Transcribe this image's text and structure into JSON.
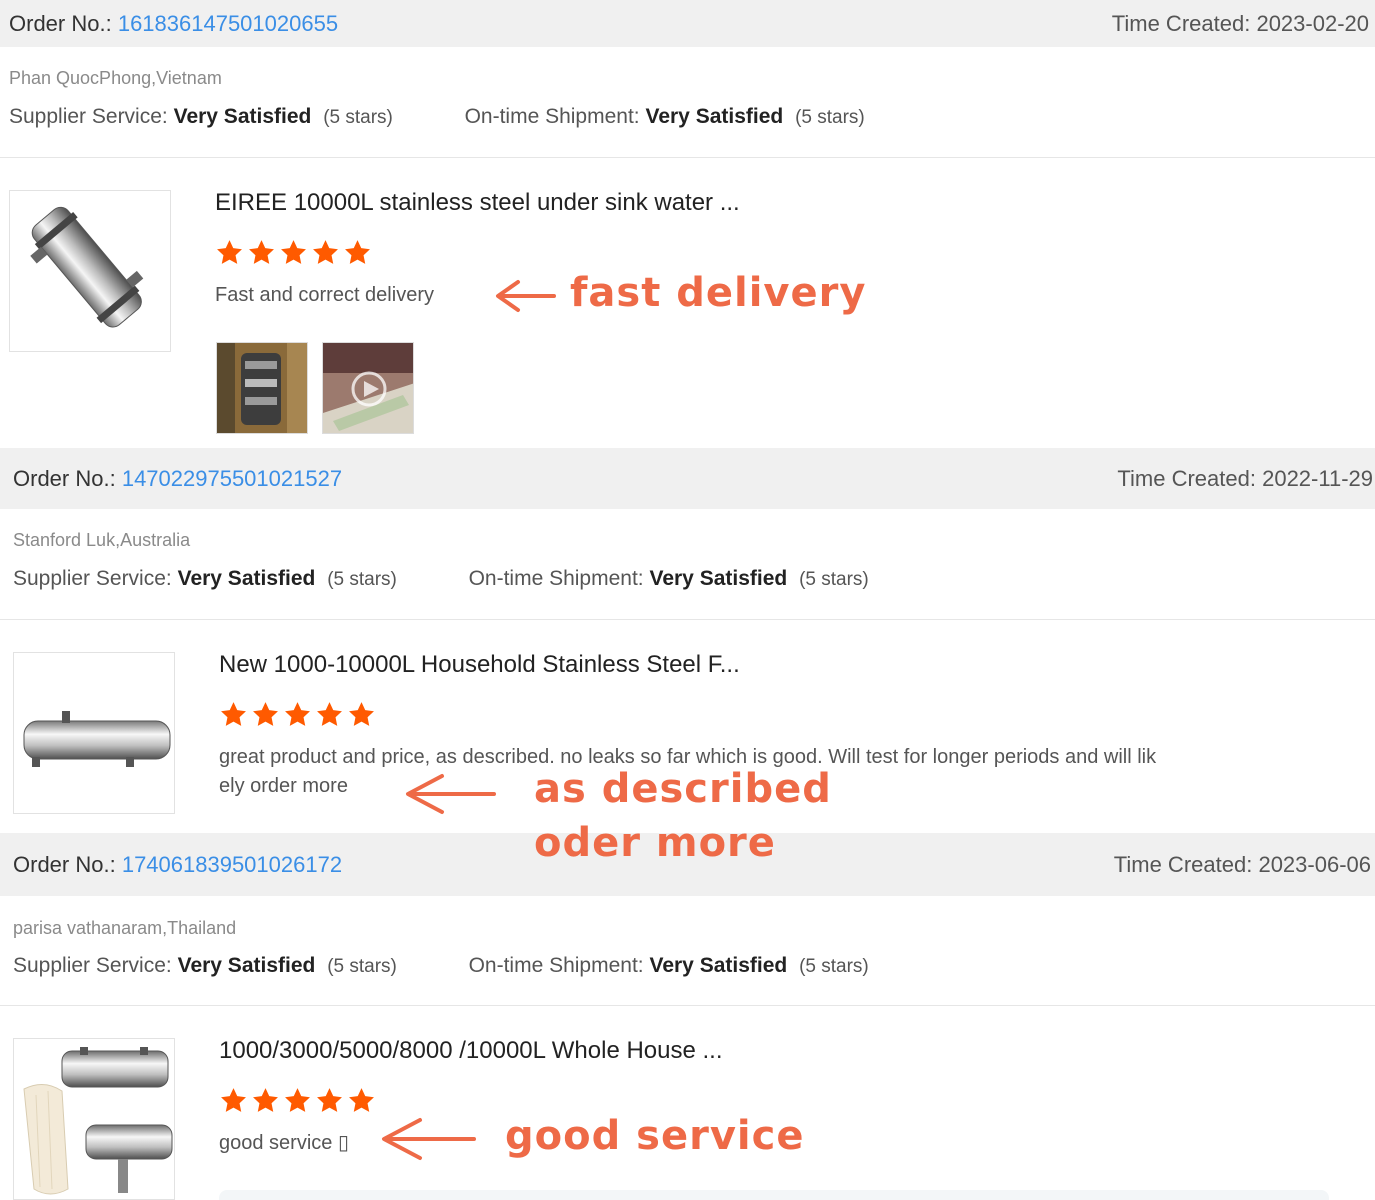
{
  "orders": [
    {
      "order_label": "Order No.:",
      "order_number": "161836147501020655",
      "time_label": "Time Created:",
      "time_value": "2023-02-20",
      "buyer": "Phan QuocPhong,Vietnam",
      "supplier_label": "Supplier Service:",
      "supplier_value": "Very Satisfied",
      "supplier_stars": "(5 stars)",
      "shipment_label": "On-time Shipment:",
      "shipment_value": "Very Satisfied",
      "shipment_stars": "(5 stars)",
      "product_title": "EIREE 10000L stainless steel under sink water ...",
      "rating": 5,
      "review": "Fast and correct delivery",
      "annotation": "fast delivery"
    },
    {
      "order_label": "Order No.:",
      "order_number": "147022975501021527",
      "time_label": "Time Created:",
      "time_value": "2022-11-29",
      "buyer": "Stanford Luk,Australia",
      "supplier_label": "Supplier Service:",
      "supplier_value": "Very Satisfied",
      "supplier_stars": "(5 stars)",
      "shipment_label": "On-time Shipment:",
      "shipment_value": "Very Satisfied",
      "shipment_stars": "(5 stars)",
      "product_title": "New 1000-10000L Household Stainless Steel F...",
      "rating": 5,
      "review_line1": "great product and price, as described. no leaks so far which is good. Will test for longer periods and will lik",
      "review_line2": "ely order more",
      "annotation_1": "as described",
      "annotation_2": "oder more"
    },
    {
      "order_label": "Order No.:",
      "order_number": "174061839501026172",
      "time_label": "Time Created:",
      "time_value": "2023-06-06",
      "buyer": "parisa vathanaram,Thailand",
      "supplier_label": "Supplier Service:",
      "supplier_value": "Very Satisfied",
      "supplier_stars": "(5 stars)",
      "shipment_label": "On-time Shipment:",
      "shipment_value": "Very Satisfied",
      "shipment_stars": "(5 stars)",
      "product_title": "1000/3000/5000/8000 /10000L Whole House ...",
      "rating": 5,
      "review": "good service ▯",
      "annotation": "good service"
    }
  ],
  "colors": {
    "link": "#3a8ee6",
    "star": "#ff5a00",
    "annotation": "#ee6a47",
    "header_bg": "#f0f0f0"
  },
  "icons": [
    "star-icon",
    "arrow-left-icon",
    "play-icon"
  ]
}
